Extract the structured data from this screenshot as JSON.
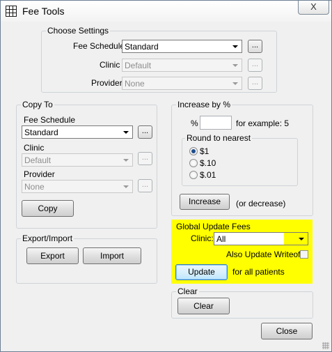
{
  "window": {
    "title": "Fee Tools",
    "close_glyph": "X"
  },
  "choose_settings": {
    "label": "Choose Settings",
    "fee_schedule_label": "Fee Schedule",
    "fee_schedule_value": "Standard",
    "clinic_label": "Clinic",
    "clinic_value": "Default",
    "provider_label": "Provider",
    "provider_value": "None",
    "ellipsis": "..."
  },
  "copy_to": {
    "label": "Copy To",
    "fee_schedule_label": "Fee Schedule",
    "fee_schedule_value": "Standard",
    "clinic_label": "Clinic",
    "clinic_value": "Default",
    "provider_label": "Provider",
    "provider_value": "None",
    "copy_button": "Copy",
    "ellipsis": "..."
  },
  "increase_by": {
    "label": "Increase by %",
    "percent_label": "%",
    "percent_value": "",
    "example_text": "for example: 5",
    "round_label": "Round to nearest",
    "options": [
      "$1",
      "$.10",
      "$.01"
    ],
    "selected_option": "$1",
    "increase_button": "Increase",
    "decrease_note": "(or decrease)"
  },
  "export_import": {
    "label": "Export/Import",
    "export_button": "Export",
    "import_button": "Import"
  },
  "global_update": {
    "label": "Global Update Fees",
    "clinic_label": "Clinic:",
    "clinic_value": "All",
    "also_update_label": "Also Update Writeoffs",
    "also_update_checked": false,
    "update_button": "Update",
    "for_all_note": "for all patients",
    "highlight_color": "#ffff00"
  },
  "clear": {
    "label": "Clear",
    "clear_button": "Clear"
  },
  "close_button": "Close"
}
